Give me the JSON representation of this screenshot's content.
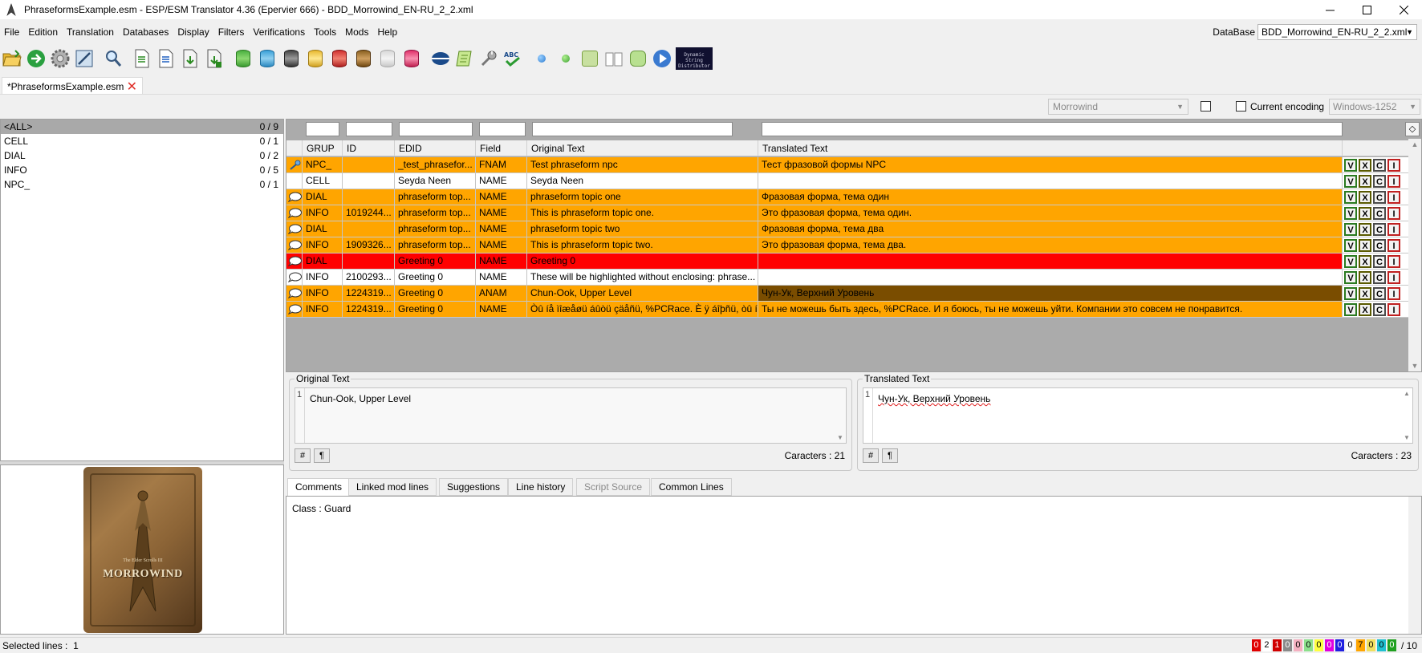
{
  "window": {
    "title": "PhraseformsExample.esm - ESP/ESM Translator 4.36 (Epervier 666) - BDD_Morrowind_EN-RU_2_2.xml"
  },
  "menu": [
    "File",
    "Edition",
    "Translation",
    "Databases",
    "Display",
    "Filters",
    "Verifications",
    "Tools",
    "Mods",
    "Help"
  ],
  "database": {
    "label": "DataBase",
    "value": "BDD_Morrowind_EN-RU_2_2.xml"
  },
  "toolbar": {
    "dsd_text": "Dynamic String Distributor",
    "icons": [
      "open-icon",
      "go-icon",
      "settings-icon",
      "edit-icon",
      "search-icon",
      "import-icon",
      "export-icon",
      "save-icon",
      "save-as-icon",
      "db-green-icon",
      "db-blue-icon",
      "db-dark-icon",
      "db-yellow-icon",
      "db-red-icon",
      "db-brown-icon",
      "db-gray-icon",
      "db-pink-icon",
      "globe-icon",
      "scroll-icon",
      "tools-icon",
      "spellcheck-icon",
      "blue-dot-icon",
      "green-dot-icon",
      "translate-icon",
      "book-icon",
      "puzzle-icon",
      "play-icon",
      "dsd-icon"
    ]
  },
  "file_tab": {
    "label": "*PhraseformsExample.esm",
    "close": "✕"
  },
  "game": {
    "value": "Morrowind"
  },
  "encoding": {
    "label": "Current encoding",
    "value": "Windows-1252"
  },
  "groups": [
    {
      "name": "<ALL>",
      "count": "0 / 9"
    },
    {
      "name": "CELL",
      "count": "0 / 1"
    },
    {
      "name": "DIAL",
      "count": "0 / 2"
    },
    {
      "name": "INFO",
      "count": "0 / 5"
    },
    {
      "name": "NPC_",
      "count": "0 / 1"
    }
  ],
  "cover": {
    "subtitle": "The Elder Scrolls III",
    "logo": "MORROWIND"
  },
  "grid": {
    "headers": [
      "GRUP",
      "ID",
      "EDID",
      "Field",
      "Original Text",
      "Translated Text"
    ],
    "btns": [
      "V",
      "X",
      "C",
      "I"
    ],
    "rows": [
      {
        "grup": "NPC_",
        "id": "",
        "edid": "_test_phrasefor...",
        "field": "FNAM",
        "orig": "Test phraseform npc",
        "trans": "Тест фразовой формы NPC",
        "bg": "#ffa500",
        "icon": "key"
      },
      {
        "grup": "CELL",
        "id": "",
        "edid": "Seyda Neen",
        "field": "NAME",
        "orig": "Seyda Neen",
        "trans": "",
        "bg": "#ffffff",
        "icon": ""
      },
      {
        "grup": "DIAL",
        "id": "",
        "edid": "phraseform top...",
        "field": "NAME",
        "orig": "phraseform topic one",
        "trans": "Фразовая форма, тема один",
        "bg": "#ffa500",
        "icon": "bubble"
      },
      {
        "grup": "INFO",
        "id": "1019244...",
        "edid": "phraseform top...",
        "field": "NAME",
        "orig": "This is phraseform topic one.",
        "trans": "Это фразовая форма, тема один.",
        "bg": "#ffa500",
        "icon": "bubble"
      },
      {
        "grup": "DIAL",
        "id": "",
        "edid": "phraseform top...",
        "field": "NAME",
        "orig": "phraseform topic two",
        "trans": "Фразовая форма, тема два",
        "bg": "#ffa500",
        "icon": "bubble"
      },
      {
        "grup": "INFO",
        "id": "1909326...",
        "edid": "phraseform top...",
        "field": "NAME",
        "orig": "This is phraseform topic two.",
        "trans": "Это фразовая форма, тема два.",
        "bg": "#ffa500",
        "icon": "bubble"
      },
      {
        "grup": "DIAL",
        "id": "",
        "edid": "Greeting 0",
        "field": "NAME",
        "orig": "Greeting 0",
        "trans": "",
        "bg": "#ff0000",
        "icon": "bubble"
      },
      {
        "grup": "INFO",
        "id": "2100293...",
        "edid": "Greeting 0",
        "field": "NAME",
        "orig": "These will be highlighted without enclosing: phrase...",
        "trans": "",
        "bg": "#ffffff",
        "icon": "bubble"
      },
      {
        "grup": "INFO",
        "id": "1224319...",
        "edid": "Greeting 0",
        "field": "ANAM",
        "orig": "Chun-Ook, Upper Level",
        "trans": "Чун-Ук, Верхний Уровень",
        "bg": "#ffa500",
        "trans_bg": "#7a4d00",
        "icon": "bubble"
      },
      {
        "grup": "INFO",
        "id": "1224319...",
        "edid": "Greeting 0",
        "field": "NAME",
        "orig": "Òû íå ìîæåøü áûòü çäåñü, %PCRace. È ÿ áîþñü, òû íå ì...",
        "trans": "Ты не можешь быть здесь, %PCRace. И я боюсь, ты не можешь уйти. Компании это совсем не понравится.",
        "bg": "#ffa500",
        "icon": "bubble"
      }
    ]
  },
  "original": {
    "legend": "Original Text",
    "line": "1",
    "text": "Chun-Ook, Upper Level",
    "hash": "#",
    "pilcrow": "¶",
    "chars": "Caracters : 21"
  },
  "translated": {
    "legend": "Translated Text",
    "line": "1",
    "text": "Чун-Ук, Верхний Уровень",
    "hash": "#",
    "pilcrow": "¶",
    "chars": "Caracters : 23"
  },
  "bottom_tabs": [
    "Comments",
    "Linked mod lines",
    "Suggestions",
    "Line history",
    "Script Source",
    "Common Lines"
  ],
  "comments": {
    "text": "Class : Guard"
  },
  "status": {
    "selected_label": "Selected lines :",
    "selected_value": "1",
    "stats": [
      {
        "v": "0",
        "bg": "#e00000",
        "fg": "#ffffff"
      },
      {
        "v": "2",
        "bg": "#ffffff",
        "fg": "#000000"
      },
      {
        "v": "1",
        "bg": "#d00000",
        "fg": "#ffffff"
      },
      {
        "v": "0",
        "bg": "#8a8a8a",
        "fg": "#ffffff"
      },
      {
        "v": "0",
        "bg": "#f4b0c0",
        "fg": "#000000"
      },
      {
        "v": "0",
        "bg": "#8ce08c",
        "fg": "#000000"
      },
      {
        "v": "0",
        "bg": "#ffff40",
        "fg": "#000000"
      },
      {
        "v": "0",
        "bg": "#e000e0",
        "fg": "#ffffff"
      },
      {
        "v": "0",
        "bg": "#2020e0",
        "fg": "#ffffff"
      },
      {
        "v": "0",
        "bg": "#ffffff",
        "fg": "#000000"
      },
      {
        "v": "7",
        "bg": "#ffa500",
        "fg": "#000000"
      },
      {
        "v": "0",
        "bg": "#f0e060",
        "fg": "#000000"
      },
      {
        "v": "0",
        "bg": "#20c0d0",
        "fg": "#000000"
      },
      {
        "v": "0",
        "bg": "#20a020",
        "fg": "#ffffff"
      }
    ],
    "total": "/ 10"
  }
}
